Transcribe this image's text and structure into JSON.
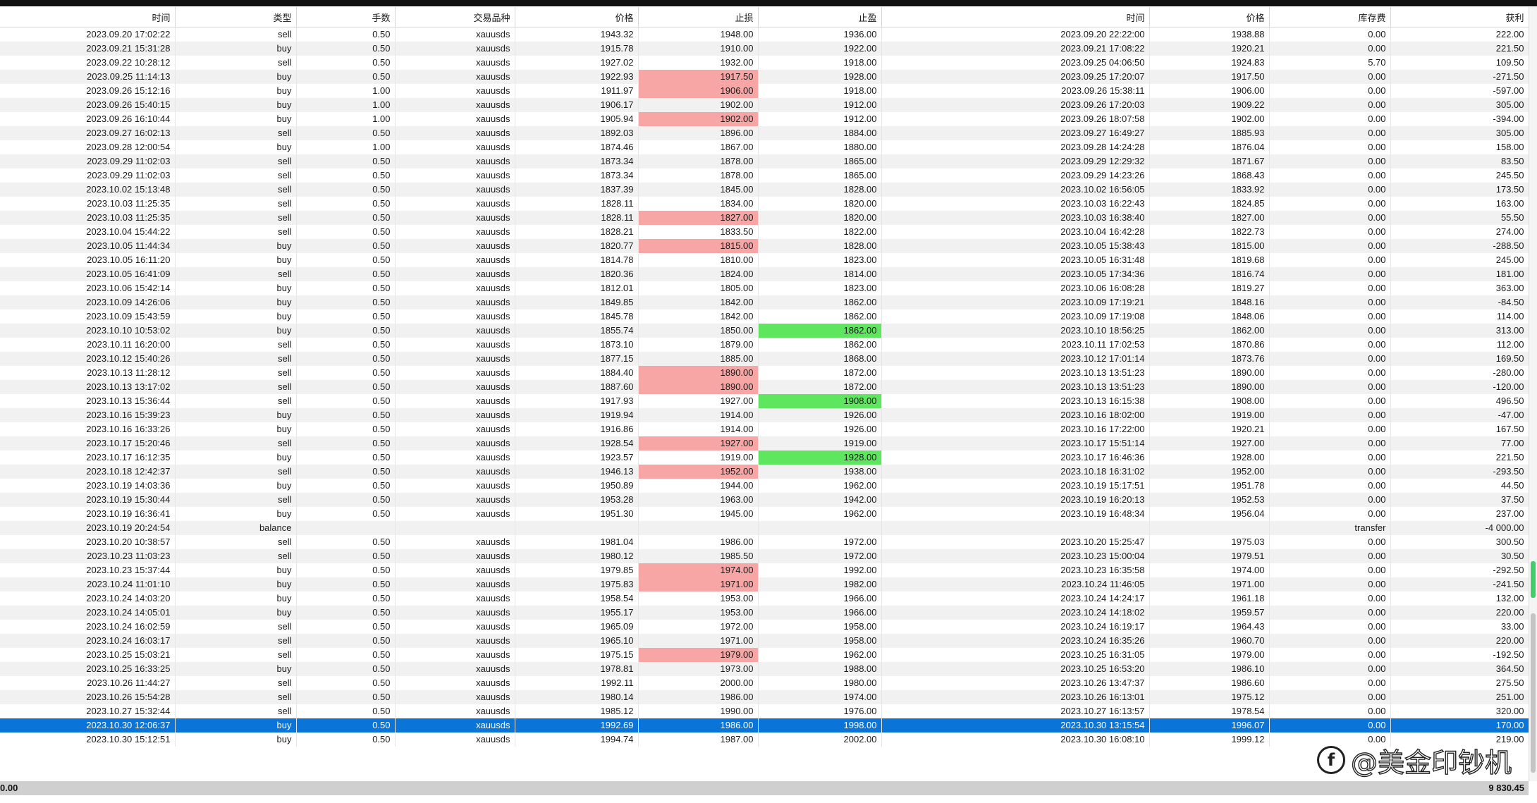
{
  "table": {
    "headers": [
      "时间",
      "类型",
      "手数",
      "交易品种",
      "价格",
      "止损",
      "止盈",
      "时间",
      "价格",
      "库存费",
      "获利"
    ],
    "rows": [
      [
        "2023.09.20 17:02:22",
        "sell",
        "0.50",
        "xauusds",
        "1943.32",
        "1948.00",
        "1936.00",
        "2023.09.20 22:22:00",
        "1938.88",
        "0.00",
        "222.00"
      ],
      [
        "2023.09.21 15:31:28",
        "buy",
        "0.50",
        "xauusds",
        "1915.78",
        "1910.00",
        "1922.00",
        "2023.09.21 17:08:22",
        "1920.21",
        "0.00",
        "221.50"
      ],
      [
        "2023.09.22 10:28:12",
        "sell",
        "0.50",
        "xauusds",
        "1927.02",
        "1932.00",
        "1918.00",
        "2023.09.25 04:06:50",
        "1924.83",
        "5.70",
        "109.50"
      ],
      [
        "2023.09.25 11:14:13",
        "buy",
        "0.50",
        "xauusds",
        "1922.93",
        "1917.50",
        "1928.00",
        "2023.09.25 17:20:07",
        "1917.50",
        "0.00",
        "-271.50"
      ],
      [
        "2023.09.26 15:12:16",
        "buy",
        "1.00",
        "xauusds",
        "1911.97",
        "1906.00",
        "1918.00",
        "2023.09.26 15:38:11",
        "1906.00",
        "0.00",
        "-597.00"
      ],
      [
        "2023.09.26 15:40:15",
        "buy",
        "1.00",
        "xauusds",
        "1906.17",
        "1902.00",
        "1912.00",
        "2023.09.26 17:20:03",
        "1909.22",
        "0.00",
        "305.00"
      ],
      [
        "2023.09.26 16:10:44",
        "buy",
        "1.00",
        "xauusds",
        "1905.94",
        "1902.00",
        "1912.00",
        "2023.09.26 18:07:58",
        "1902.00",
        "0.00",
        "-394.00"
      ],
      [
        "2023.09.27 16:02:13",
        "sell",
        "0.50",
        "xauusds",
        "1892.03",
        "1896.00",
        "1884.00",
        "2023.09.27 16:49:27",
        "1885.93",
        "0.00",
        "305.00"
      ],
      [
        "2023.09.28 12:00:54",
        "buy",
        "1.00",
        "xauusds",
        "1874.46",
        "1867.00",
        "1880.00",
        "2023.09.28 14:24:28",
        "1876.04",
        "0.00",
        "158.00"
      ],
      [
        "2023.09.29 11:02:03",
        "sell",
        "0.50",
        "xauusds",
        "1873.34",
        "1878.00",
        "1865.00",
        "2023.09.29 12:29:32",
        "1871.67",
        "0.00",
        "83.50"
      ],
      [
        "2023.09.29 11:02:03",
        "sell",
        "0.50",
        "xauusds",
        "1873.34",
        "1878.00",
        "1865.00",
        "2023.09.29 14:23:26",
        "1868.43",
        "0.00",
        "245.50"
      ],
      [
        "2023.10.02 15:13:48",
        "sell",
        "0.50",
        "xauusds",
        "1837.39",
        "1845.00",
        "1828.00",
        "2023.10.02 16:56:05",
        "1833.92",
        "0.00",
        "173.50"
      ],
      [
        "2023.10.03 11:25:35",
        "sell",
        "0.50",
        "xauusds",
        "1828.11",
        "1834.00",
        "1820.00",
        "2023.10.03 16:22:43",
        "1824.85",
        "0.00",
        "163.00"
      ],
      [
        "2023.10.03 11:25:35",
        "sell",
        "0.50",
        "xauusds",
        "1828.11",
        "1827.00",
        "1820.00",
        "2023.10.03 16:38:40",
        "1827.00",
        "0.00",
        "55.50"
      ],
      [
        "2023.10.04 15:44:22",
        "sell",
        "0.50",
        "xauusds",
        "1828.21",
        "1833.50",
        "1822.00",
        "2023.10.04 16:42:28",
        "1822.73",
        "0.00",
        "274.00"
      ],
      [
        "2023.10.05 11:44:34",
        "buy",
        "0.50",
        "xauusds",
        "1820.77",
        "1815.00",
        "1828.00",
        "2023.10.05 15:38:43",
        "1815.00",
        "0.00",
        "-288.50"
      ],
      [
        "2023.10.05 16:11:20",
        "buy",
        "0.50",
        "xauusds",
        "1814.78",
        "1810.00",
        "1823.00",
        "2023.10.05 16:31:48",
        "1819.68",
        "0.00",
        "245.00"
      ],
      [
        "2023.10.05 16:41:09",
        "sell",
        "0.50",
        "xauusds",
        "1820.36",
        "1824.00",
        "1814.00",
        "2023.10.05 17:34:36",
        "1816.74",
        "0.00",
        "181.00"
      ],
      [
        "2023.10.06 15:42:14",
        "buy",
        "0.50",
        "xauusds",
        "1812.01",
        "1805.00",
        "1823.00",
        "2023.10.06 16:08:28",
        "1819.27",
        "0.00",
        "363.00"
      ],
      [
        "2023.10.09 14:26:06",
        "buy",
        "0.50",
        "xauusds",
        "1849.85",
        "1842.00",
        "1862.00",
        "2023.10.09 17:19:21",
        "1848.16",
        "0.00",
        "-84.50"
      ],
      [
        "2023.10.09 15:43:59",
        "buy",
        "0.50",
        "xauusds",
        "1845.78",
        "1842.00",
        "1862.00",
        "2023.10.09 17:19:08",
        "1848.06",
        "0.00",
        "114.00"
      ],
      [
        "2023.10.10 10:53:02",
        "buy",
        "0.50",
        "xauusds",
        "1855.74",
        "1850.00",
        "1862.00",
        "2023.10.10 18:56:25",
        "1862.00",
        "0.00",
        "313.00"
      ],
      [
        "2023.10.11 16:20:00",
        "sell",
        "0.50",
        "xauusds",
        "1873.10",
        "1879.00",
        "1862.00",
        "2023.10.11 17:02:53",
        "1870.86",
        "0.00",
        "112.00"
      ],
      [
        "2023.10.12 15:40:26",
        "sell",
        "0.50",
        "xauusds",
        "1877.15",
        "1885.00",
        "1868.00",
        "2023.10.12 17:01:14",
        "1873.76",
        "0.00",
        "169.50"
      ],
      [
        "2023.10.13 11:28:12",
        "sell",
        "0.50",
        "xauusds",
        "1884.40",
        "1890.00",
        "1872.00",
        "2023.10.13 13:51:23",
        "1890.00",
        "0.00",
        "-280.00"
      ],
      [
        "2023.10.13 13:17:02",
        "sell",
        "0.50",
        "xauusds",
        "1887.60",
        "1890.00",
        "1872.00",
        "2023.10.13 13:51:23",
        "1890.00",
        "0.00",
        "-120.00"
      ],
      [
        "2023.10.13 15:36:44",
        "sell",
        "0.50",
        "xauusds",
        "1917.93",
        "1927.00",
        "1908.00",
        "2023.10.13 16:15:38",
        "1908.00",
        "0.00",
        "496.50"
      ],
      [
        "2023.10.16 15:39:23",
        "buy",
        "0.50",
        "xauusds",
        "1919.94",
        "1914.00",
        "1926.00",
        "2023.10.16 18:02:00",
        "1919.00",
        "0.00",
        "-47.00"
      ],
      [
        "2023.10.16 16:33:26",
        "buy",
        "0.50",
        "xauusds",
        "1916.86",
        "1914.00",
        "1926.00",
        "2023.10.16 17:22:00",
        "1920.21",
        "0.00",
        "167.50"
      ],
      [
        "2023.10.17 15:20:46",
        "sell",
        "0.50",
        "xauusds",
        "1928.54",
        "1927.00",
        "1919.00",
        "2023.10.17 15:51:14",
        "1927.00",
        "0.00",
        "77.00"
      ],
      [
        "2023.10.17 16:12:35",
        "buy",
        "0.50",
        "xauusds",
        "1923.57",
        "1919.00",
        "1928.00",
        "2023.10.17 16:46:36",
        "1928.00",
        "0.00",
        "221.50"
      ],
      [
        "2023.10.18 12:42:37",
        "sell",
        "0.50",
        "xauusds",
        "1946.13",
        "1952.00",
        "1938.00",
        "2023.10.18 16:31:02",
        "1952.00",
        "0.00",
        "-293.50"
      ],
      [
        "2023.10.19 14:03:36",
        "buy",
        "0.50",
        "xauusds",
        "1950.89",
        "1944.00",
        "1962.00",
        "2023.10.19 15:17:51",
        "1951.78",
        "0.00",
        "44.50"
      ],
      [
        "2023.10.19 15:30:44",
        "sell",
        "0.50",
        "xauusds",
        "1953.28",
        "1963.00",
        "1942.00",
        "2023.10.19 16:20:13",
        "1952.53",
        "0.00",
        "37.50"
      ],
      [
        "2023.10.19 16:36:41",
        "buy",
        "0.50",
        "xauusds",
        "1951.30",
        "1945.00",
        "1962.00",
        "2023.10.19 16:48:34",
        "1956.04",
        "0.00",
        "237.00"
      ],
      [
        "2023.10.19 20:24:54",
        "balance",
        "",
        "",
        "",
        "",
        "",
        "",
        "",
        "transfer",
        "-4 000.00"
      ],
      [
        "2023.10.20 10:38:57",
        "sell",
        "0.50",
        "xauusds",
        "1981.04",
        "1986.00",
        "1972.00",
        "2023.10.20 15:25:47",
        "1975.03",
        "0.00",
        "300.50"
      ],
      [
        "2023.10.23 11:03:23",
        "sell",
        "0.50",
        "xauusds",
        "1980.12",
        "1985.50",
        "1972.00",
        "2023.10.23 15:00:04",
        "1979.51",
        "0.00",
        "30.50"
      ],
      [
        "2023.10.23 15:37:44",
        "buy",
        "0.50",
        "xauusds",
        "1979.85",
        "1974.00",
        "1992.00",
        "2023.10.23 16:35:58",
        "1974.00",
        "0.00",
        "-292.50"
      ],
      [
        "2023.10.24 11:01:10",
        "buy",
        "0.50",
        "xauusds",
        "1975.83",
        "1971.00",
        "1982.00",
        "2023.10.24 11:46:05",
        "1971.00",
        "0.00",
        "-241.50"
      ],
      [
        "2023.10.24 14:03:20",
        "buy",
        "0.50",
        "xauusds",
        "1958.54",
        "1953.00",
        "1966.00",
        "2023.10.24 14:24:17",
        "1961.18",
        "0.00",
        "132.00"
      ],
      [
        "2023.10.24 14:05:01",
        "buy",
        "0.50",
        "xauusds",
        "1955.17",
        "1953.00",
        "1966.00",
        "2023.10.24 14:18:02",
        "1959.57",
        "0.00",
        "220.00"
      ],
      [
        "2023.10.24 16:02:59",
        "sell",
        "0.50",
        "xauusds",
        "1965.09",
        "1972.00",
        "1958.00",
        "2023.10.24 16:19:17",
        "1964.43",
        "0.00",
        "33.00"
      ],
      [
        "2023.10.24 16:03:17",
        "sell",
        "0.50",
        "xauusds",
        "1965.10",
        "1971.00",
        "1958.00",
        "2023.10.24 16:35:26",
        "1960.70",
        "0.00",
        "220.00"
      ],
      [
        "2023.10.25 15:03:21",
        "sell",
        "0.50",
        "xauusds",
        "1975.15",
        "1979.00",
        "1962.00",
        "2023.10.25 16:31:05",
        "1979.00",
        "0.00",
        "-192.50"
      ],
      [
        "2023.10.25 16:33:25",
        "buy",
        "0.50",
        "xauusds",
        "1978.81",
        "1973.00",
        "1988.00",
        "2023.10.25 16:53:20",
        "1986.10",
        "0.00",
        "364.50"
      ],
      [
        "2023.10.26 11:44:27",
        "sell",
        "0.50",
        "xauusds",
        "1992.11",
        "2000.00",
        "1980.00",
        "2023.10.26 13:47:37",
        "1986.60",
        "0.00",
        "275.50"
      ],
      [
        "2023.10.26 15:54:28",
        "sell",
        "0.50",
        "xauusds",
        "1980.14",
        "1986.00",
        "1974.00",
        "2023.10.26 16:13:01",
        "1975.12",
        "0.00",
        "251.00"
      ],
      [
        "2023.10.27 15:32:44",
        "sell",
        "0.50",
        "xauusds",
        "1985.12",
        "1990.00",
        "1976.00",
        "2023.10.27 16:13:57",
        "1978.54",
        "0.00",
        "320.00"
      ],
      [
        "2023.10.30 12:06:37",
        "buy",
        "0.50",
        "xauusds",
        "1992.69",
        "1986.00",
        "1998.00",
        "2023.10.30 13:15:54",
        "1996.07",
        "0.00",
        "170.00"
      ],
      [
        "2023.10.30 15:12:51",
        "buy",
        "0.50",
        "xauusds",
        "1994.74",
        "1987.00",
        "2002.00",
        "2023.10.30 16:08:10",
        "1999.12",
        "0.00",
        "219.00"
      ]
    ],
    "selected_row": 49,
    "highlight_sl_rows": [
      3,
      4,
      6,
      13,
      15,
      24,
      25,
      29,
      31,
      38,
      39,
      44
    ],
    "highlight_tp_rows": [
      21,
      26,
      30
    ],
    "colors": {
      "selected": "#0a74d8",
      "stop_loss_hit": "#f7a5a5",
      "take_profit_hit": "#5ee65e"
    }
  },
  "totals": {
    "left": "0.00",
    "profit": "9 830.45"
  },
  "watermark": {
    "text": "@美金印钞机",
    "icon": "brand-logo-icon",
    "icon_glyph": "f"
  }
}
